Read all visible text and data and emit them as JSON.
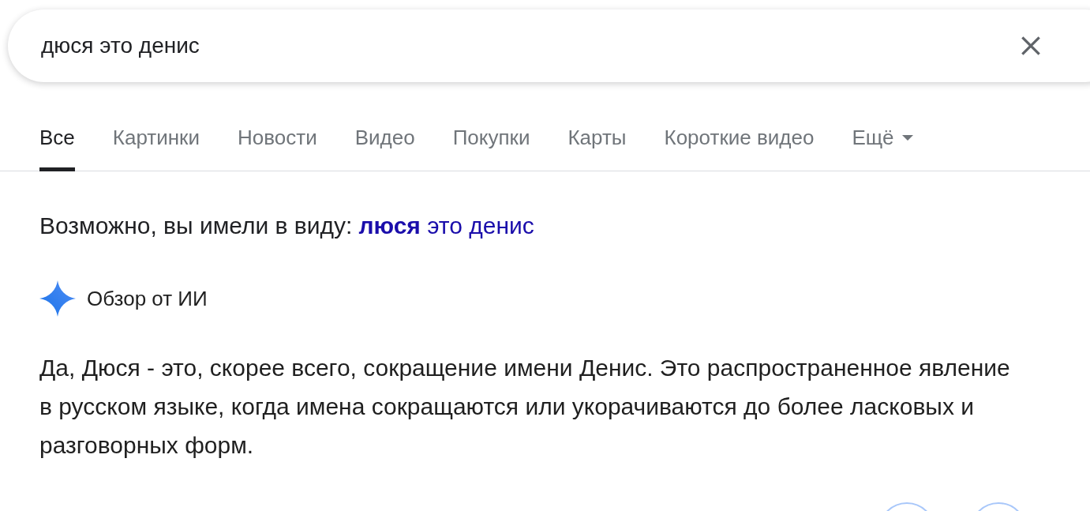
{
  "search": {
    "value": "дюся это денис"
  },
  "tabs": [
    {
      "label": "Все",
      "selected": true,
      "kind": "plain"
    },
    {
      "label": "Картинки",
      "selected": false,
      "kind": "plain"
    },
    {
      "label": "Новости",
      "selected": false,
      "kind": "plain"
    },
    {
      "label": "Видео",
      "selected": false,
      "kind": "plain"
    },
    {
      "label": "Покупки",
      "selected": false,
      "kind": "plain"
    },
    {
      "label": "Карты",
      "selected": false,
      "kind": "plain"
    },
    {
      "label": "Короткие видео",
      "selected": false,
      "kind": "plain"
    },
    {
      "label": "Ещё",
      "selected": false,
      "kind": "menu"
    }
  ],
  "suggestion": {
    "prefix": "Возможно, вы имели в виду:",
    "link": "**люся** это денис"
  },
  "ai_overview": {
    "title": "Обзор от ИИ",
    "text": "Да, Дюся - это, скорее всего, сокращение имени Денис. Это распространенное явление в русском языке, когда имена сокращаются или укорачиваются до более ласковых и разговорных форм."
  }
}
